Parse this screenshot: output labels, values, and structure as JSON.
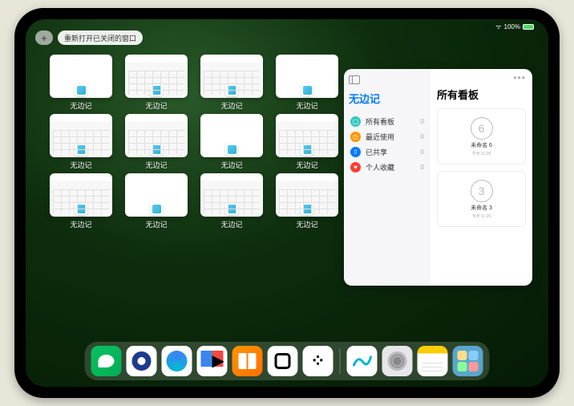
{
  "status": {
    "battery": "100%",
    "signal": "●●●"
  },
  "top_controls": {
    "plus": "+",
    "reopen_label": "重新打开已关闭的窗口"
  },
  "app_tiles": [
    {
      "label": "无边记",
      "thumb": "blank"
    },
    {
      "label": "无边记",
      "thumb": "cal"
    },
    {
      "label": "无边记",
      "thumb": "cal"
    },
    {
      "label": "无边记",
      "thumb": "blank"
    },
    {
      "label": "无边记",
      "thumb": "cal"
    },
    {
      "label": "无边记",
      "thumb": "cal"
    },
    {
      "label": "无边记",
      "thumb": "blank"
    },
    {
      "label": "无边记",
      "thumb": "cal"
    },
    {
      "label": "无边记",
      "thumb": "cal"
    },
    {
      "label": "无边记",
      "thumb": "blank"
    },
    {
      "label": "无边记",
      "thumb": "cal"
    },
    {
      "label": "无边记",
      "thumb": "cal"
    }
  ],
  "side_panel": {
    "left_title": "无边记",
    "left_title_color": "#007aff",
    "items": [
      {
        "icon_color": "#34c7c2",
        "glyph": "▢",
        "label": "所有看板",
        "count": 0
      },
      {
        "icon_color": "#ff9500",
        "glyph": "◷",
        "label": "最近使用",
        "count": 0
      },
      {
        "icon_color": "#007aff",
        "glyph": "⇧",
        "label": "已共享",
        "count": 0
      },
      {
        "icon_color": "#ff3b30",
        "glyph": "♥",
        "label": "个人收藏",
        "count": 0
      }
    ],
    "right_title": "所有看板",
    "boards": [
      {
        "drawing": "6",
        "label": "未命名 6",
        "sub": "今天 11:25"
      },
      {
        "drawing": "3",
        "label": "未命名 3",
        "sub": "今天 11:25"
      }
    ]
  },
  "dock": {
    "apps": [
      {
        "name": "wechat"
      },
      {
        "name": "qq-browser"
      },
      {
        "name": "qq-music"
      },
      {
        "name": "tencent-video"
      },
      {
        "name": "books"
      },
      {
        "name": "obsidian"
      },
      {
        "name": "xmind"
      }
    ],
    "recent": [
      {
        "name": "freeform"
      },
      {
        "name": "settings"
      },
      {
        "name": "notes"
      },
      {
        "name": "app-library"
      }
    ]
  }
}
